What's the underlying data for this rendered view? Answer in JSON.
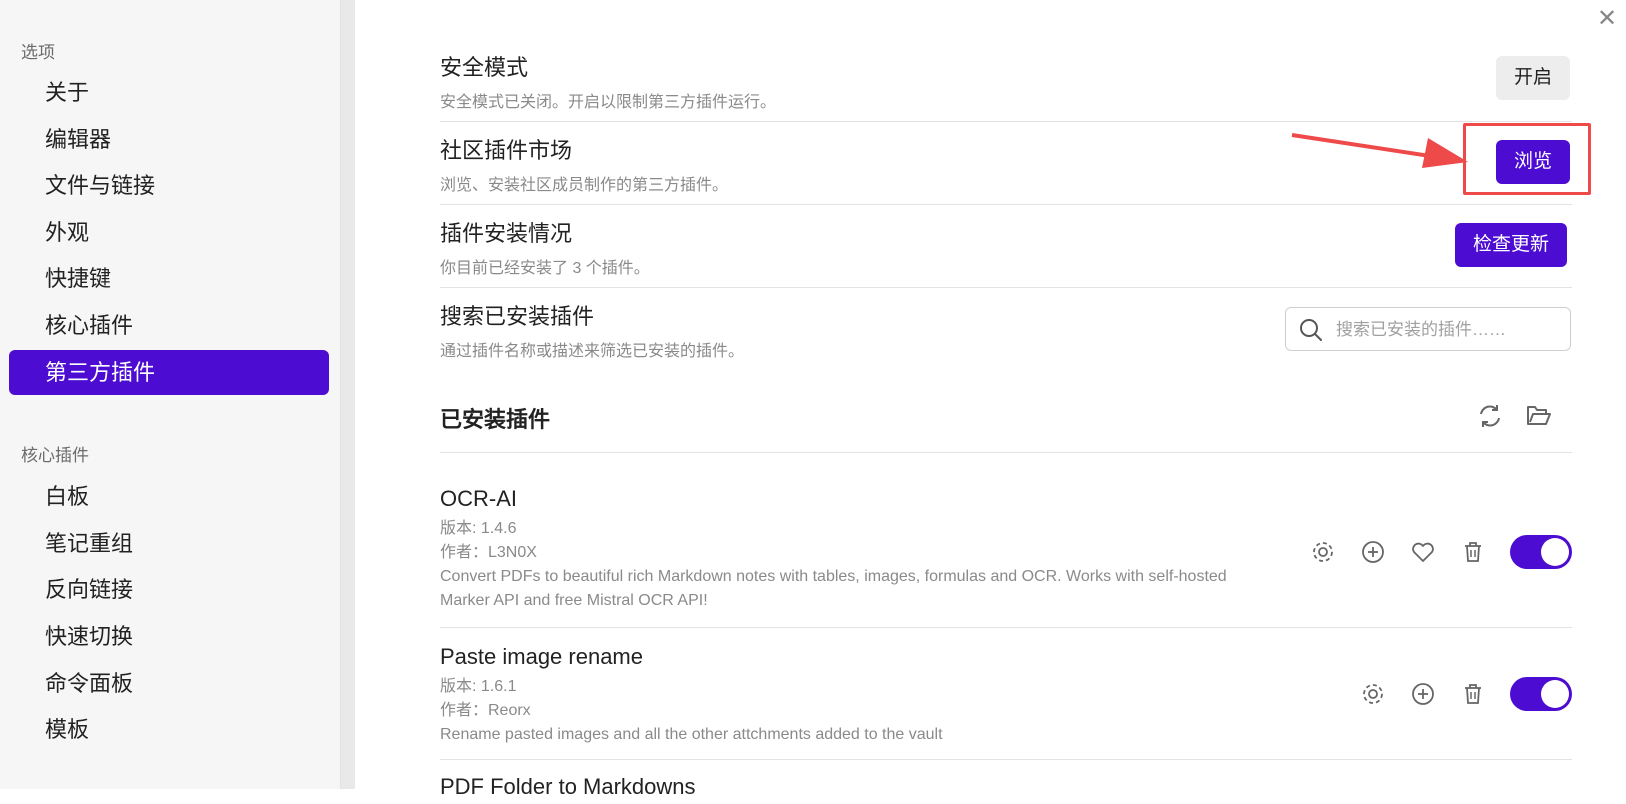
{
  "sidebar": {
    "section1_title": "选项",
    "options": [
      {
        "label": "关于"
      },
      {
        "label": "编辑器"
      },
      {
        "label": "文件与链接"
      },
      {
        "label": "外观"
      },
      {
        "label": "快捷键"
      },
      {
        "label": "核心插件"
      },
      {
        "label": "第三方插件",
        "active": true
      }
    ],
    "section2_title": "核心插件",
    "core_plugins": [
      {
        "label": "白板"
      },
      {
        "label": "笔记重组"
      },
      {
        "label": "反向链接"
      },
      {
        "label": "快速切换"
      },
      {
        "label": "命令面板"
      },
      {
        "label": "模板"
      }
    ]
  },
  "settings": {
    "safe_mode": {
      "title": "安全模式",
      "desc": "安全模式已关闭。开启以限制第三方插件运行。",
      "button": "开启"
    },
    "community": {
      "title": "社区插件市场",
      "desc": "浏览、安装社区成员制作的第三方插件。",
      "button": "浏览"
    },
    "install_status": {
      "title": "插件安装情况",
      "desc": "你目前已经安装了 3 个插件。",
      "button": "检查更新"
    },
    "search": {
      "title": "搜索已安装插件",
      "desc": "通过插件名称或描述来筛选已安装的插件。",
      "placeholder": "搜索已安装的插件……"
    }
  },
  "installed": {
    "title": "已安装插件",
    "plugins": [
      {
        "name": "OCR-AI",
        "version": "版本: 1.4.6",
        "author": "作者：L3N0X",
        "desc": "Convert PDFs to beautiful rich Markdown notes with tables, images, formulas and OCR. Works with self-hosted Marker API and free Mistral OCR API!",
        "enabled": true
      },
      {
        "name": "Paste image rename",
        "version": "版本: 1.6.1",
        "author": "作者：Reorx",
        "desc": "Rename pasted images and all the other attchments added to the vault",
        "enabled": true
      },
      {
        "name": "PDF Folder to Markdowns"
      }
    ]
  },
  "colors": {
    "accent": "#4c0cd1",
    "annotation": "#ef4a4a"
  }
}
